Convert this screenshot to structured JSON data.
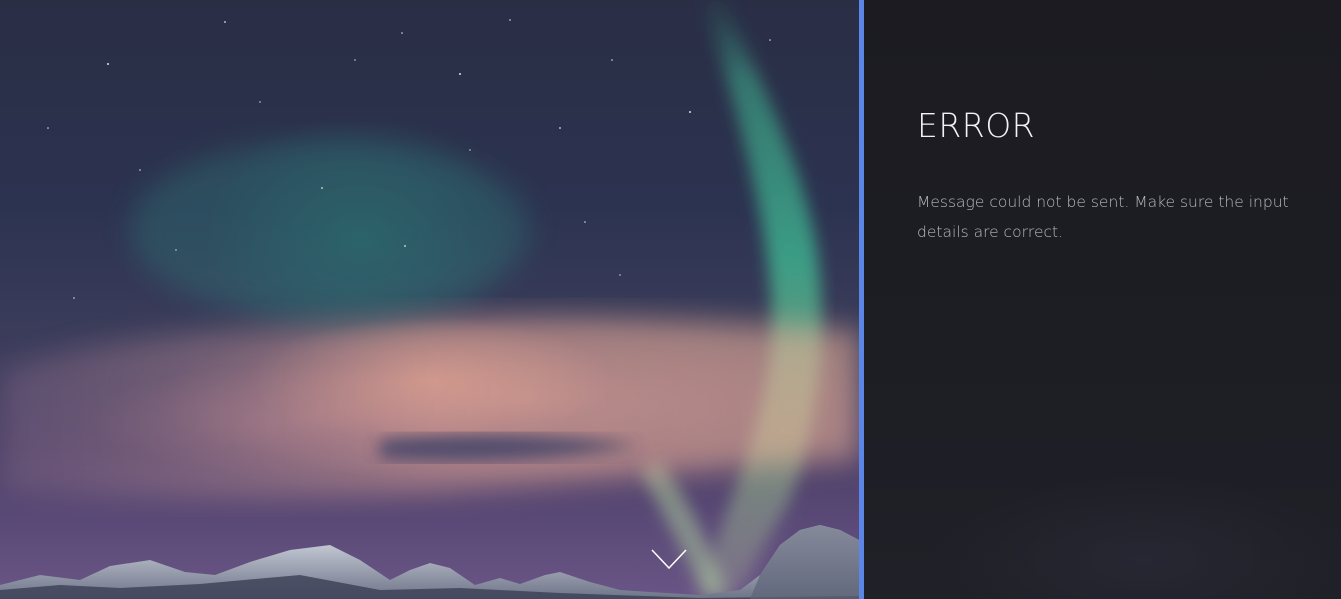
{
  "error_panel": {
    "title": "ERROR",
    "message": "Message could not be sent. Make sure the input details are correct."
  },
  "hero": {
    "scroll_icon": "chevron-down-icon"
  },
  "colors": {
    "divider": "#5b86e5",
    "panel_background": "#1c1c22",
    "title_text": "#f2f2f4",
    "message_text": "#b9b9c2"
  }
}
